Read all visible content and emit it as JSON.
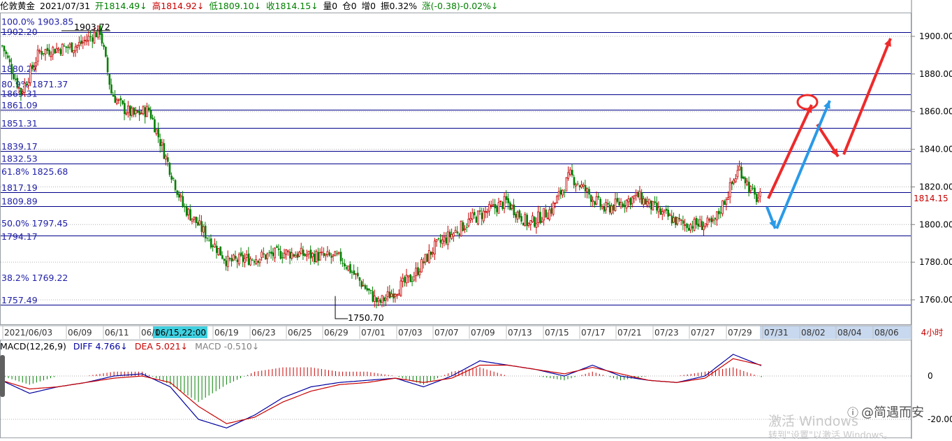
{
  "header": {
    "instrument": "伦敦黄金",
    "date": "2021/07/31",
    "open": "开1814.49↓",
    "high": "高1814.92↓",
    "low": "低1809.10↓",
    "close": "收1814.15↓",
    "volume": "量0",
    "open_interest": "仓0",
    "increase": "增0",
    "amplitude": "振0.32%",
    "change": "涨(-0.38)-0.02%↓"
  },
  "macd_header": {
    "name": "MACD(12,26,9)",
    "diff": "DIFF 4.766↓",
    "dea": "DEA 5.021↓",
    "macd": "MACD -0.510↓"
  },
  "period_label": "4小时",
  "current_price_label": "1814.15",
  "highlight_date": "06/15,22:00",
  "watermark": {
    "line1": "激活 Windows",
    "line2": "转到\"设置\"以激活 Windows。"
  },
  "brand": {
    "logo": "ⓘ",
    "text": "@简遇而安"
  },
  "colors": {
    "up": "#c80000",
    "down": "#008000",
    "level_line": "#00008b",
    "diff_line": "#0000a0",
    "dea_line": "#c80000",
    "arrow_red": "#ee2a2a",
    "arrow_blue": "#2a9ae8",
    "highlight": "#3fd0e0",
    "future_axis_bg": "#c8d8ee"
  },
  "chart_data": [
    {
      "type": "candlestick",
      "title": "",
      "ylim": [
        1750,
        1910
      ],
      "y_ticks": [
        "1900.00",
        "1880.00",
        "1860.00",
        "1840.00",
        "1820.00",
        "1800.00",
        "1780.00",
        "1760.00"
      ],
      "x_tick_labels": [
        "2021/06/03",
        "06/09",
        "06/11",
        "06/1",
        "06/15,22:00",
        "06/19",
        "06/23",
        "06/25",
        "06/29",
        "07/01",
        "07/03",
        "07/07",
        "07/09",
        "07/13",
        "07/15",
        "07/17",
        "07/21",
        "07/23",
        "07/27",
        "07/29",
        "07/31",
        "08/02",
        "08/04",
        "08/06"
      ],
      "price_path": {
        "x_index": [
          0,
          10,
          20,
          40,
          52,
          58,
          64,
          70,
          78,
          96,
          120,
          150,
          180,
          200,
          218,
          230,
          250,
          268,
          280,
          292,
          302,
          320,
          338,
          350,
          362,
          378,
          392,
          400
        ],
        "close": [
          1895,
          1870,
          1892,
          1895,
          1903,
          1870,
          1862,
          1858,
          1861,
          1810,
          1780,
          1785,
          1782,
          1758,
          1772,
          1788,
          1803,
          1812,
          1800,
          1808,
          1826,
          1808,
          1815,
          1806,
          1800,
          1800,
          1830,
          1814.15
        ]
      },
      "horizontal_levels": [
        {
          "label": "100.0% 1903.85",
          "value": 1903.85
        },
        {
          "label": "1902.20",
          "value": 1902.2
        },
        {
          "label": "1880.27",
          "value": 1880.27
        },
        {
          "label": "80.9% 1871.37",
          "value": 1871.37
        },
        {
          "label": "1869.31",
          "value": 1869.31
        },
        {
          "label": "1861.09",
          "value": 1861.09
        },
        {
          "label": "1851.31",
          "value": 1851.31
        },
        {
          "label": "1839.17",
          "value": 1839.17
        },
        {
          "label": "1832.53",
          "value": 1832.53
        },
        {
          "label": "61.8% 1825.68",
          "value": 1825.68
        },
        {
          "label": "1817.19",
          "value": 1817.19
        },
        {
          "label": "1809.89",
          "value": 1809.89
        },
        {
          "label": "50.0% 1797.45",
          "value": 1797.45
        },
        {
          "label": "1794.17",
          "value": 1794.17
        },
        {
          "label": "38.2% 1769.22",
          "value": 1769.22
        },
        {
          "label": "1757.49",
          "value": 1757.49
        }
      ],
      "annotations": [
        {
          "text": "1903.72",
          "value": 1903.72
        },
        {
          "text": "1750.70",
          "value": 1750.7
        }
      ],
      "last_price": 1814.15
    },
    {
      "type": "line",
      "title": "MACD(12,26,9)",
      "ylim": [
        -28,
        16
      ],
      "y_ticks": [
        "0",
        "-20.00"
      ],
      "series": [
        {
          "name": "DIFF",
          "values": [
            -2,
            -8,
            -5,
            -3,
            0,
            1,
            -5,
            -20,
            -24,
            -18,
            -10,
            -5,
            -3,
            -2,
            -1,
            -5,
            0,
            7,
            5,
            3,
            0,
            5,
            0,
            -2,
            -3,
            0,
            10,
            4.766
          ]
        },
        {
          "name": "DEA",
          "values": [
            -2,
            -6,
            -5,
            -3,
            -1,
            0,
            -3,
            -14,
            -22,
            -19,
            -12,
            -7,
            -4,
            -3,
            -1,
            -3,
            -1,
            5,
            5,
            3,
            1,
            4,
            1,
            -2,
            -3,
            -1,
            8,
            5.021
          ]
        }
      ],
      "macd_last": -0.51
    }
  ]
}
